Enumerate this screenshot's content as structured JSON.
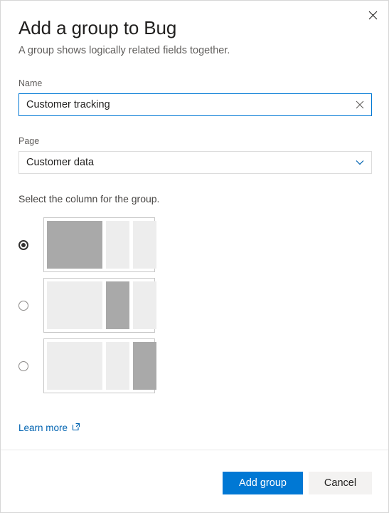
{
  "dialog": {
    "title": "Add a group to Bug",
    "subtitle": "A group shows logically related fields together.",
    "close_label": "Close"
  },
  "form": {
    "name": {
      "label": "Name",
      "value": "Customer tracking",
      "placeholder": "",
      "clear_label": "Clear"
    },
    "page": {
      "label": "Page",
      "value": "Customer data",
      "options": [
        "Customer data"
      ]
    }
  },
  "column_chooser": {
    "caption": "Select the column for the group.",
    "selected_index": 0,
    "options": [
      {
        "id": "column-left",
        "highlighted_cell": 0
      },
      {
        "id": "column-middle",
        "highlighted_cell": 1
      },
      {
        "id": "column-right",
        "highlighted_cell": 2
      }
    ]
  },
  "learn_more": {
    "label": "Learn more",
    "icon": "external-link-icon"
  },
  "footer": {
    "primary_label": "Add group",
    "secondary_label": "Cancel"
  },
  "colors": {
    "accent": "#0078d4",
    "link": "#0063b1",
    "cell_on": "#a9a9a9",
    "cell_off": "#ededed"
  }
}
